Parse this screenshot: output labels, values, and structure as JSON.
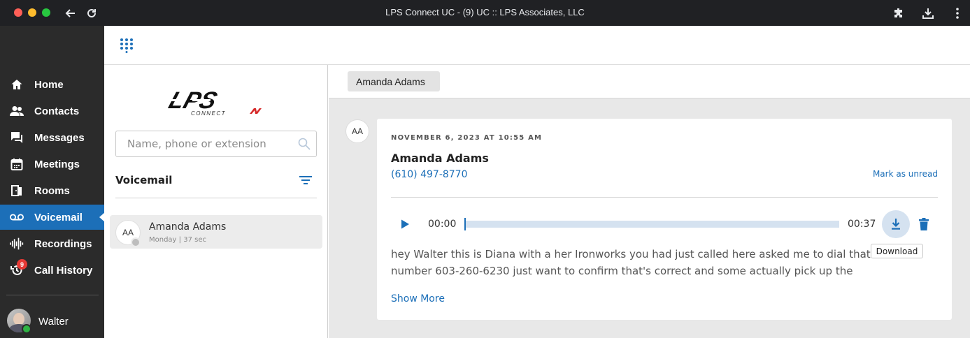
{
  "window": {
    "title": "LPS Connect UC - (9) UC :: LPS Associates, LLC"
  },
  "sidebar": {
    "items": [
      {
        "label": "Home",
        "icon": "home-icon"
      },
      {
        "label": "Contacts",
        "icon": "contacts-icon"
      },
      {
        "label": "Messages",
        "icon": "messages-icon"
      },
      {
        "label": "Meetings",
        "icon": "calendar-icon"
      },
      {
        "label": "Rooms",
        "icon": "rooms-icon"
      },
      {
        "label": "Voicemail",
        "icon": "voicemail-icon",
        "active": true
      },
      {
        "label": "Recordings",
        "icon": "waveform-icon"
      },
      {
        "label": "Call History",
        "icon": "history-icon",
        "badge": "9"
      }
    ],
    "user": {
      "name": "Walter",
      "status": "online"
    }
  },
  "search": {
    "placeholder": "Name, phone or extension"
  },
  "voicemail_list": {
    "heading": "Voicemail",
    "items": [
      {
        "initials": "AA",
        "name": "Amanda Adams",
        "meta": "Monday | 37 sec"
      }
    ]
  },
  "tabs": [
    {
      "label": "Amanda Adams"
    }
  ],
  "message": {
    "initials": "AA",
    "date": "NOVEMBER 6, 2023 AT 10:55 AM",
    "caller": "Amanda Adams",
    "phone": "(610) 497-8770",
    "mark_unread": "Mark as unread",
    "player": {
      "current": "00:00",
      "duration": "00:37",
      "progress_fraction": 0.0,
      "download_tooltip": "Download"
    },
    "transcript": "hey Walter this is Diana with a her Ironworks you had just called here asked me to dial that number 603-260-6230 just want to confirm that's correct and some actually pick up the phone and the",
    "show_more": "Show More"
  },
  "colors": {
    "accent": "#1c6fb8",
    "sidebar_bg": "#2b2b2b",
    "badge": "#e53935",
    "online": "#2fb344"
  }
}
